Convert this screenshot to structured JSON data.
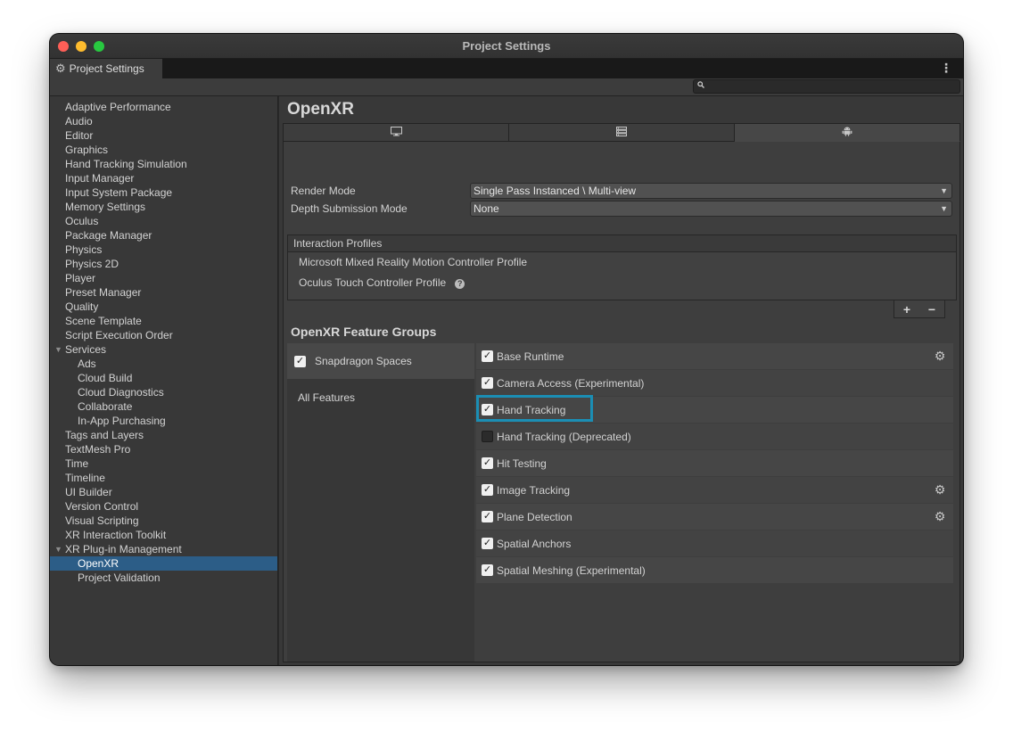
{
  "window": {
    "title": "Project Settings"
  },
  "tab": {
    "label": "Project Settings",
    "icon": "gear-icon"
  },
  "search": {
    "placeholder": "",
    "icon": "search-icon"
  },
  "sidebar": {
    "items": [
      {
        "label": "Adaptive Performance",
        "level": 0
      },
      {
        "label": "Audio",
        "level": 0
      },
      {
        "label": "Editor",
        "level": 0
      },
      {
        "label": "Graphics",
        "level": 0
      },
      {
        "label": "Hand Tracking Simulation",
        "level": 0
      },
      {
        "label": "Input Manager",
        "level": 0
      },
      {
        "label": "Input System Package",
        "level": 0
      },
      {
        "label": "Memory Settings",
        "level": 0
      },
      {
        "label": "Oculus",
        "level": 0
      },
      {
        "label": "Package Manager",
        "level": 0
      },
      {
        "label": "Physics",
        "level": 0
      },
      {
        "label": "Physics 2D",
        "level": 0
      },
      {
        "label": "Player",
        "level": 0
      },
      {
        "label": "Preset Manager",
        "level": 0
      },
      {
        "label": "Quality",
        "level": 0
      },
      {
        "label": "Scene Template",
        "level": 0
      },
      {
        "label": "Script Execution Order",
        "level": 0
      },
      {
        "label": "Services",
        "level": 0,
        "foldout": true
      },
      {
        "label": "Ads",
        "level": 1
      },
      {
        "label": "Cloud Build",
        "level": 1
      },
      {
        "label": "Cloud Diagnostics",
        "level": 1
      },
      {
        "label": "Collaborate",
        "level": 1
      },
      {
        "label": "In-App Purchasing",
        "level": 1
      },
      {
        "label": "Tags and Layers",
        "level": 0
      },
      {
        "label": "TextMesh Pro",
        "level": 0
      },
      {
        "label": "Time",
        "level": 0
      },
      {
        "label": "Timeline",
        "level": 0
      },
      {
        "label": "UI Builder",
        "level": 0
      },
      {
        "label": "Version Control",
        "level": 0
      },
      {
        "label": "Visual Scripting",
        "level": 0
      },
      {
        "label": "XR Interaction Toolkit",
        "level": 0
      },
      {
        "label": "XR Plug-in Management",
        "level": 0,
        "foldout": true
      },
      {
        "label": "OpenXR",
        "level": 1,
        "selected": true
      },
      {
        "label": "Project Validation",
        "level": 1
      }
    ]
  },
  "main": {
    "title": "OpenXR",
    "platform_tabs": [
      {
        "name": "standalone",
        "icon": "monitor-icon"
      },
      {
        "name": "server",
        "icon": "server-icon"
      },
      {
        "name": "android",
        "icon": "android-icon",
        "active": true
      }
    ],
    "render_mode": {
      "label": "Render Mode",
      "value": "Single Pass Instanced \\ Multi-view"
    },
    "depth_submission": {
      "label": "Depth Submission Mode",
      "value": "None"
    },
    "interaction_profiles": {
      "header": "Interaction Profiles",
      "items": [
        "Microsoft Mixed Reality Motion Controller Profile",
        "Oculus Touch Controller Profile"
      ],
      "add": "+",
      "remove": "−"
    },
    "feature_groups": {
      "title": "OpenXR Feature Groups",
      "groups": [
        {
          "label": "Snapdragon Spaces",
          "checked": true,
          "selected": true
        },
        {
          "label": "All Features"
        }
      ],
      "features": [
        {
          "label": "Base Runtime",
          "checked": true,
          "gear": true
        },
        {
          "label": "Camera Access (Experimental)",
          "checked": true
        },
        {
          "label": "Hand Tracking",
          "checked": true,
          "highlighted": true
        },
        {
          "label": "Hand Tracking (Deprecated)",
          "checked": false
        },
        {
          "label": "Hit Testing",
          "checked": true
        },
        {
          "label": "Image Tracking",
          "checked": true,
          "gear": true
        },
        {
          "label": "Plane Detection",
          "checked": true,
          "gear": true
        },
        {
          "label": "Spatial Anchors",
          "checked": true
        },
        {
          "label": "Spatial Meshing (Experimental)",
          "checked": true
        }
      ]
    }
  },
  "colors": {
    "selection": "#2c5d87",
    "highlight_outline": "#1b8eb4"
  }
}
